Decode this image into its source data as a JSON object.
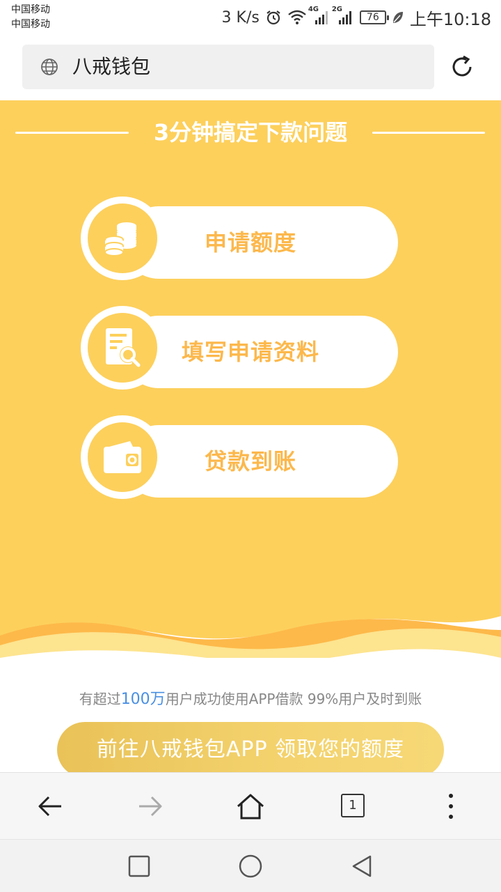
{
  "status_bar": {
    "carrier_1": "中国移动",
    "carrier_2": "中国移动",
    "net_speed": "3 K/s",
    "signal_1": "4G",
    "signal_2": "2G",
    "battery": "76",
    "time": "上午10:18"
  },
  "address_bar": {
    "title": "八戒钱包",
    "icons": [
      "globe-icon",
      "refresh-icon"
    ]
  },
  "hero": {
    "title": "3分钟搞定下款问题",
    "steps": [
      {
        "label": "申请额度",
        "icon": "coins-icon"
      },
      {
        "label": "填写申请资料",
        "icon": "document-search-icon"
      },
      {
        "label": "贷款到账",
        "icon": "wallet-icon"
      }
    ]
  },
  "stats": {
    "prefix": "有超过",
    "highlight": "100万",
    "suffix": "用户成功使用APP借款 99%用户及时到账"
  },
  "cta": {
    "label": "前往八戒钱包APP 领取您的额度"
  },
  "toolbar": {
    "tab_count": "1",
    "icons": [
      "back-arrow-icon",
      "forward-arrow-icon",
      "home-icon",
      "tabs-icon",
      "more-vert-icon"
    ]
  },
  "nav_bar": {
    "icons": [
      "recents-square-icon",
      "home-circle-icon",
      "back-triangle-icon"
    ]
  },
  "colors": {
    "hero_yellow": "#fdd05c",
    "step_text": "#fcb84c",
    "wave_orange": "#fdb94a",
    "wave_light": "#fde48f",
    "highlight_blue": "#4a90e2",
    "cta_gold": "#efcb62"
  }
}
